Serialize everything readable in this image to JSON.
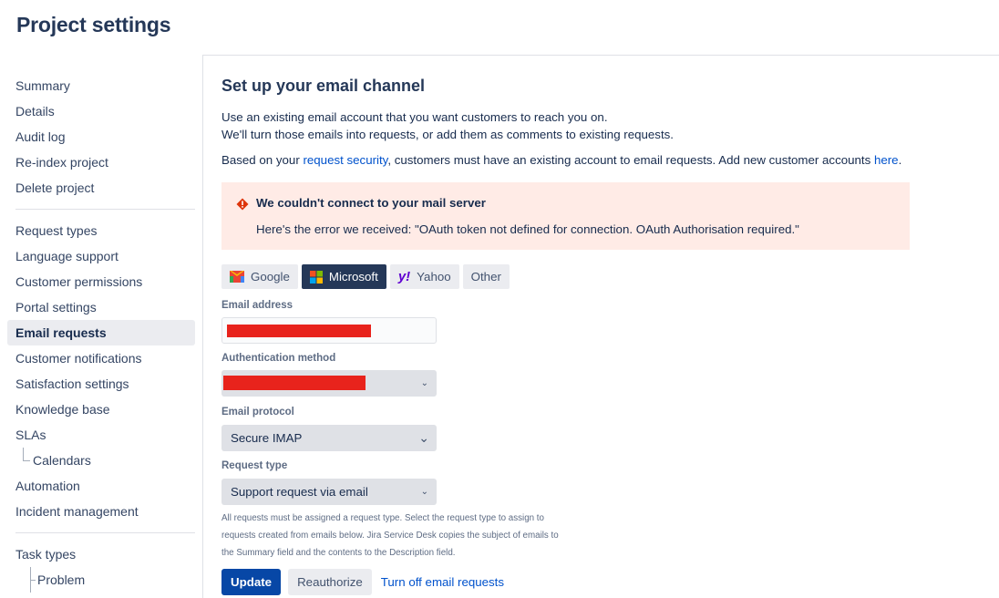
{
  "page_title": "Project settings",
  "sidebar": {
    "group1": [
      {
        "label": "Summary"
      },
      {
        "label": "Details"
      },
      {
        "label": "Audit log"
      },
      {
        "label": "Re-index project"
      },
      {
        "label": "Delete project"
      }
    ],
    "group2": [
      {
        "label": "Request types"
      },
      {
        "label": "Language support"
      },
      {
        "label": "Customer permissions"
      },
      {
        "label": "Portal settings"
      },
      {
        "label": "Email requests",
        "active": true
      },
      {
        "label": "Customer notifications"
      },
      {
        "label": "Satisfaction settings"
      },
      {
        "label": "Knowledge base"
      },
      {
        "label": "SLAs"
      },
      {
        "label": "Calendars",
        "sub": true
      },
      {
        "label": "Automation"
      },
      {
        "label": "Incident management"
      }
    ],
    "group3": [
      {
        "label": "Task types"
      },
      {
        "label": "Problem",
        "sub": true
      }
    ]
  },
  "main": {
    "heading": "Set up your email channel",
    "intro_line1": "Use an existing email account that you want customers to reach you on.",
    "intro_line2": "We'll turn those emails into requests, or add them as comments to existing requests.",
    "security_prefix": "Based on your ",
    "security_link": "request security",
    "security_mid": ", customers must have an existing account to email requests. Add new customer accounts ",
    "here_link": "here",
    "security_suffix": ".",
    "alert": {
      "title": "We couldn't connect to your mail server",
      "text": "Here's the error we received: \"OAuth token not defined for connection. OAuth Authorisation required.\"",
      "color": "#de350b"
    },
    "providers": [
      {
        "label": "Google",
        "icon": "gmail-icon"
      },
      {
        "label": "Microsoft",
        "icon": "microsoft-icon",
        "active": true
      },
      {
        "label": "Yahoo",
        "icon": "yahoo-icon"
      },
      {
        "label": "Other"
      }
    ],
    "email_label": "Email address",
    "auth_label": "Authentication method",
    "protocol_label": "Email protocol",
    "protocol_value": "Secure IMAP",
    "request_type_label": "Request type",
    "request_type_value": "Support request via email",
    "help_line1": "All requests must be assigned a request type. Select the request type to assign to",
    "help_line2": "requests created from emails below. Jira Service Desk copies the subject of emails to",
    "help_line3": "the Summary field and the contents to the Description field.",
    "update_button": "Update",
    "reauthorize_button": "Reauthorize",
    "turn_off_link": "Turn off email requests"
  }
}
